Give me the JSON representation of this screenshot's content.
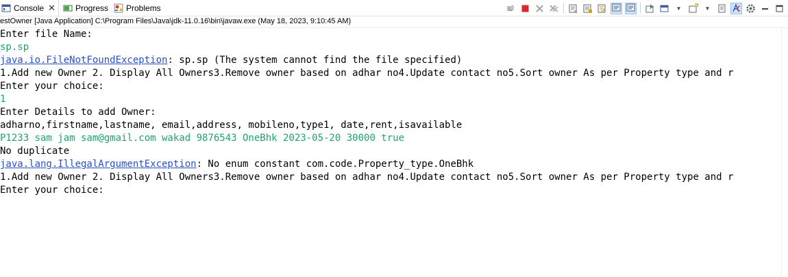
{
  "tabs": {
    "console": "Console",
    "progress": "Progress",
    "problems": "Problems"
  },
  "launch_description": "estOwner [Java Application] C:\\Program Files\\Java\\jdk-11.0.16\\bin\\javaw.exe  (May 18, 2023, 9:10:45 AM)",
  "console_lines": {
    "l1": "Enter file Name:",
    "l2": "sp.sp",
    "l3_exception": "java.io.FileNotFoundException",
    "l3_rest": ": sp.sp (The system cannot find the file specified)",
    "l4": "1.Add new Owner 2. Display All Owners3.Remove owner based on adhar no4.Update contact no5.Sort owner As per Property type and r",
    "l5": "Enter your choice:",
    "l6": "1",
    "l7": "Enter Details to add Owner:",
    "l8": "adharno,firstname,lastname, email,address, mobileno,type1, date,rent,isavailable",
    "l9": "P1233 sam jam sam@gmail.com wakad 9876543 OneBhk 2023-05-20 30000 true",
    "l10": "No duplicate",
    "l11_exception": "java.lang.IllegalArgumentException",
    "l11_rest": ": No enum constant com.code.Property_type.OneBhk",
    "l12": "1.Add new Owner 2. Display All Owners3.Remove owner based on adhar no4.Update contact no5.Sort owner As per Property type and r",
    "l13": "Enter your choice:"
  },
  "colors": {
    "input_text": "#1fa36b",
    "link": "#2a50c8",
    "terminate_red": "#d32a2a"
  },
  "icons": [
    "console-icon",
    "progress-icon",
    "problems-icon",
    "close-icon",
    "terminate-relaunch-icon",
    "terminate-icon",
    "remove-launch-icon",
    "remove-all-terminated-icon",
    "clear-console-icon",
    "scroll-lock-icon",
    "word-wrap-icon",
    "show-on-stdout-icon",
    "show-on-stderr-icon",
    "pin-console-icon",
    "display-selected-console-icon",
    "open-console-icon",
    "toggle-icon",
    "settings-icon",
    "minimize-icon",
    "maximize-icon"
  ]
}
